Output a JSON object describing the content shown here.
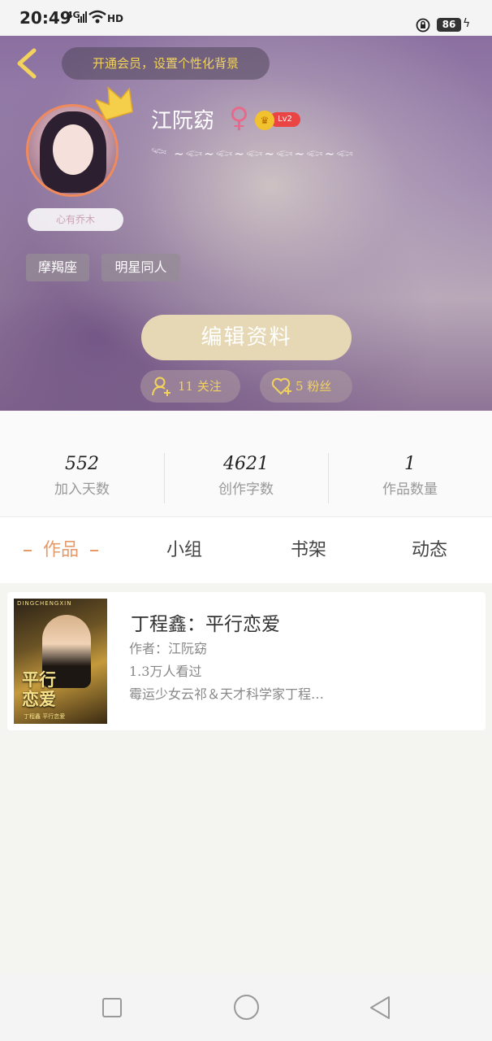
{
  "status_bar": {
    "time": "20:49",
    "network": "4G",
    "hd": "HD",
    "battery": "86"
  },
  "header": {
    "vip_banner": "开通会员，设置个性化背景",
    "username": "江阮窈",
    "gender_symbol": "♀",
    "level": "Lv2",
    "signature": "心有乔木",
    "fish_decoration": "𓆝 ~𓆟~𓆟~𓆟~𓆟~𓆟~𓆟",
    "tags": [
      "摩羯座",
      "明星同人"
    ],
    "edit_button": "编辑资料",
    "following": "11 关注",
    "fans": "5 粉丝",
    "colors": {
      "accent_yellow": "#f3d35b",
      "edit_button_bg": "#e6d8b4",
      "avatar_border": "#f08a5d"
    }
  },
  "stats": [
    {
      "value": "552",
      "label": "加入天数"
    },
    {
      "value": "4621",
      "label": "创作字数"
    },
    {
      "value": "1",
      "label": "作品数量"
    }
  ],
  "tabs": {
    "works": "作品",
    "groups": "小组",
    "shelf": "书架",
    "feed": "动态",
    "active": "works",
    "active_color": "#e69a6a"
  },
  "works": [
    {
      "title": "丁程鑫：平行恋爱",
      "author": "作者：江阮窈",
      "views": "1.3万人看过",
      "description": "霉运少女云祁＆天才科学家丁程…",
      "cover_title_line1": "平行",
      "cover_title_line2": "恋爱",
      "cover_top_text": "DINGCHENGXIN",
      "cover_bottom_text": "丁程鑫 平行恋爱"
    }
  ],
  "icons": {
    "back": "chevron-left-icon",
    "crown": "crown-icon",
    "follow": "user-plus-icon",
    "fans": "heart-plus-icon"
  }
}
